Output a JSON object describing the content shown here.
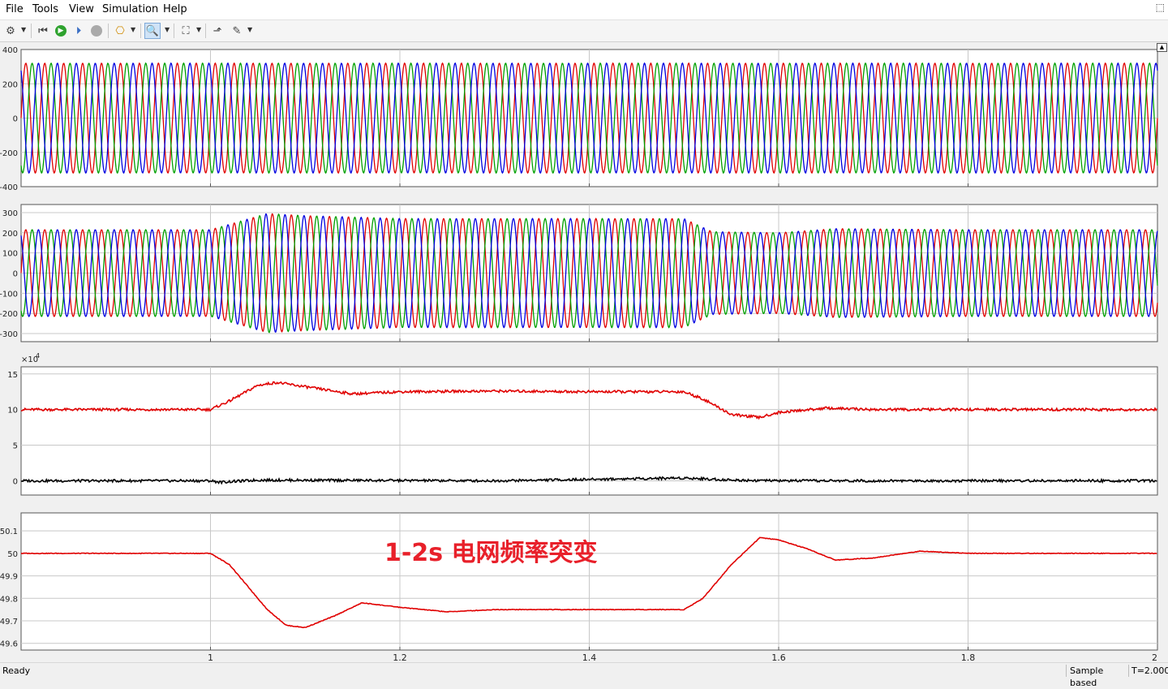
{
  "menu": {
    "items": [
      "File",
      "Tools",
      "View",
      "Simulation",
      "Help"
    ],
    "restore_icon": "restore-icon"
  },
  "toolbar": {
    "icons": [
      "settings-icon",
      "step-back-icon",
      "run-icon",
      "step-forward-icon",
      "stop-icon",
      "highlight-icon",
      "zoom-in-icon",
      "fit-to-view-icon",
      "triggers-icon",
      "style-icon"
    ],
    "zoom_active": true
  },
  "chart_data": [
    {
      "type": "line",
      "description_series": "three-phase sinusoid",
      "x_range": [
        0.8,
        2.0
      ],
      "ylim": [
        -400,
        400
      ],
      "yticks": [
        400,
        200,
        0,
        -200,
        -400
      ],
      "xtick_positions": [
        1,
        1.2,
        1.4,
        1.6,
        1.8,
        2
      ],
      "grid": true,
      "series": [
        {
          "color": "#e00000",
          "values": {
            "frequency_hz": 50,
            "amplitude": 320,
            "phase_deg": 0
          }
        },
        {
          "color": "#00a000",
          "values": {
            "frequency_hz": 50,
            "amplitude": 320,
            "phase_deg": -120
          }
        },
        {
          "color": "#0000e0",
          "values": {
            "frequency_hz": 50,
            "amplitude": 320,
            "phase_deg": 120
          }
        }
      ]
    },
    {
      "type": "line",
      "x_range": [
        0.8,
        2.0
      ],
      "ylim": [
        -340,
        340
      ],
      "yticks": [
        300,
        200,
        100,
        0,
        -100,
        -200,
        -300
      ],
      "grid": true,
      "envelope": [
        {
          "x": 0.8,
          "y": 215
        },
        {
          "x": 1.0,
          "y": 215
        },
        {
          "x": 1.06,
          "y": 295
        },
        {
          "x": 1.1,
          "y": 285
        },
        {
          "x": 1.2,
          "y": 270
        },
        {
          "x": 1.5,
          "y": 270
        },
        {
          "x": 1.53,
          "y": 205
        },
        {
          "x": 1.6,
          "y": 200
        },
        {
          "x": 1.66,
          "y": 220
        },
        {
          "x": 1.8,
          "y": 215
        },
        {
          "x": 2.0,
          "y": 215
        }
      ],
      "frequency_segments": [
        {
          "x": [
            0.8,
            1.0
          ],
          "hz": 50
        },
        {
          "x": [
            1.0,
            1.5
          ],
          "hz": 49.75
        },
        {
          "x": [
            1.5,
            1.6
          ],
          "hz": 50.05
        },
        {
          "x": [
            1.6,
            2.0
          ],
          "hz": 50
        }
      ],
      "series": [
        {
          "color": "#e00000",
          "phase_deg": 0
        },
        {
          "color": "#00a000",
          "phase_deg": -120
        },
        {
          "color": "#0000e0",
          "phase_deg": 120
        }
      ]
    },
    {
      "type": "line",
      "x_range": [
        0.8,
        2.0
      ],
      "ylim": [
        -2,
        16
      ],
      "yticks": [
        15,
        10,
        5,
        0
      ],
      "exponent_label": "×10",
      "exponent_power": "4",
      "grid": true,
      "series": [
        {
          "color": "#e00000",
          "points": [
            [
              0.8,
              10
            ],
            [
              1.0,
              10
            ],
            [
              1.02,
              11.2
            ],
            [
              1.05,
              13.4
            ],
            [
              1.07,
              13.8
            ],
            [
              1.1,
              13.2
            ],
            [
              1.15,
              12.2
            ],
            [
              1.2,
              12.5
            ],
            [
              1.3,
              12.6
            ],
            [
              1.4,
              12.5
            ],
            [
              1.5,
              12.5
            ],
            [
              1.52,
              11.5
            ],
            [
              1.55,
              9.3
            ],
            [
              1.58,
              8.9
            ],
            [
              1.6,
              9.6
            ],
            [
              1.65,
              10.2
            ],
            [
              1.7,
              10.0
            ],
            [
              2.0,
              10.0
            ]
          ]
        },
        {
          "color": "#000000",
          "points": [
            [
              0.8,
              0
            ],
            [
              1.0,
              0
            ],
            [
              1.01,
              -0.2
            ],
            [
              1.05,
              0.1
            ],
            [
              1.3,
              0.0
            ],
            [
              1.5,
              0.4
            ],
            [
              1.55,
              0.1
            ],
            [
              1.6,
              0.0
            ],
            [
              2.0,
              0.0
            ]
          ]
        }
      ]
    },
    {
      "type": "line",
      "x_range": [
        0.8,
        2.0
      ],
      "ylim": [
        49.57,
        50.18
      ],
      "yticks": [
        50.1,
        50,
        49.9,
        49.8,
        49.7,
        49.6
      ],
      "xticks": [
        1,
        1.2,
        1.4,
        1.6,
        1.8,
        2
      ],
      "xticklabels": [
        "1",
        "1.2",
        "1.4",
        "1.6",
        "1.8",
        "2"
      ],
      "grid": true,
      "series": [
        {
          "color": "#e00000",
          "points": [
            [
              0.8,
              50.0
            ],
            [
              1.0,
              50.0
            ],
            [
              1.02,
              49.95
            ],
            [
              1.04,
              49.85
            ],
            [
              1.06,
              49.75
            ],
            [
              1.08,
              49.68
            ],
            [
              1.1,
              49.67
            ],
            [
              1.13,
              49.72
            ],
            [
              1.16,
              49.78
            ],
            [
              1.2,
              49.76
            ],
            [
              1.25,
              49.74
            ],
            [
              1.3,
              49.75
            ],
            [
              1.4,
              49.75
            ],
            [
              1.5,
              49.75
            ],
            [
              1.52,
              49.8
            ],
            [
              1.55,
              49.95
            ],
            [
              1.58,
              50.07
            ],
            [
              1.6,
              50.06
            ],
            [
              1.63,
              50.02
            ],
            [
              1.66,
              49.97
            ],
            [
              1.7,
              49.98
            ],
            [
              1.75,
              50.01
            ],
            [
              1.8,
              50.0
            ],
            [
              2.0,
              50.0
            ]
          ]
        }
      ]
    }
  ],
  "annotation": "1-2s 电网频率突变",
  "status": {
    "text": "Ready",
    "mode": "Sample based",
    "time": "T=2.000"
  }
}
